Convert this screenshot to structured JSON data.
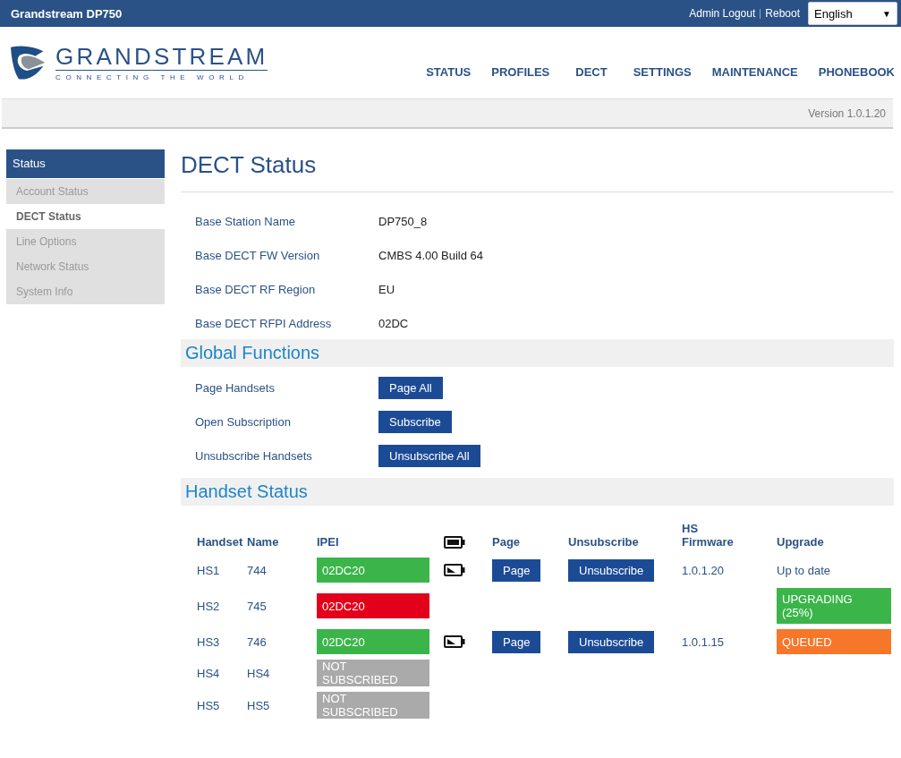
{
  "top_bar": {
    "title": "Grandstream DP750",
    "links": [
      "Admin Logout",
      "Reboot"
    ],
    "language": {
      "value": "English",
      "caret": "▼"
    }
  },
  "logo": {
    "name": "GRANDSTREAM",
    "tagline": "CONNECTING THE WORLD"
  },
  "nav": [
    {
      "label": "STATUS"
    },
    {
      "label": "PROFILES"
    },
    {
      "label": "DECT"
    },
    {
      "label": "SETTINGS"
    },
    {
      "label": "MAINTENANCE"
    },
    {
      "label": "PHONEBOOK"
    }
  ],
  "version": "Version 1.0.1.20",
  "sidebar": {
    "title": "Status",
    "items": [
      {
        "label": "Account Status",
        "selected": false
      },
      {
        "label": "DECT Status",
        "selected": true
      },
      {
        "label": "Line Options",
        "selected": false
      },
      {
        "label": "Network Status",
        "selected": false
      },
      {
        "label": "System Info",
        "selected": false
      }
    ]
  },
  "page_title": "DECT Status",
  "info": [
    {
      "label": "Base Station Name",
      "value": "DP750_8"
    },
    {
      "label": "Base DECT FW Version",
      "value": "CMBS 4.00 Build 64"
    },
    {
      "label": "Base DECT RF Region",
      "value": "EU"
    },
    {
      "label": "Base DECT RFPI Address",
      "value": "02DC"
    }
  ],
  "global_functions": {
    "title": "Global Functions",
    "rows": [
      {
        "label": "Page Handsets",
        "button": "Page All"
      },
      {
        "label": "Open Subscription",
        "button": "Subscribe"
      },
      {
        "label": "Unsubscribe Handsets",
        "button": "Unsubscribe All"
      }
    ]
  },
  "handset_status": {
    "title": "Handset Status",
    "columns": [
      "Handset",
      "Name",
      "IPEI",
      "Page",
      "Unsubscribe",
      "HS Firmware",
      "Upgrade"
    ],
    "rows": [
      {
        "handset": "HS1",
        "name": "744",
        "ipei": "02DC20",
        "color": "#3bb54a",
        "battery": true,
        "page": "Page",
        "unsubscribe": "Unsubscribe",
        "firmware": "1.0.1.20",
        "upgrade": {
          "kind": "text",
          "text": "Up to date"
        }
      },
      {
        "handset": "HS2",
        "name": "745",
        "ipei": "02DC20",
        "color": "#e2001a",
        "battery": false,
        "upgrade": {
          "kind": "badge",
          "text": "UPGRADING (25%)",
          "color": "#3bb54a"
        }
      },
      {
        "handset": "HS3",
        "name": "746",
        "ipei": "02DC20",
        "color": "#3bb54a",
        "battery": true,
        "page": "Page",
        "unsubscribe": "Unsubscribe",
        "firmware": "1.0.1.15",
        "upgrade": {
          "kind": "badge",
          "text": "QUEUED",
          "color": "#f7772a"
        }
      },
      {
        "handset": "HS4",
        "name": "HS4",
        "ipei": "NOT SUBSCRIBED",
        "color": "#aaaaaa",
        "battery": false
      },
      {
        "handset": "HS5",
        "name": "HS5",
        "ipei": "NOT SUBSCRIBED",
        "color": "#aaaaaa",
        "battery": false
      }
    ]
  }
}
